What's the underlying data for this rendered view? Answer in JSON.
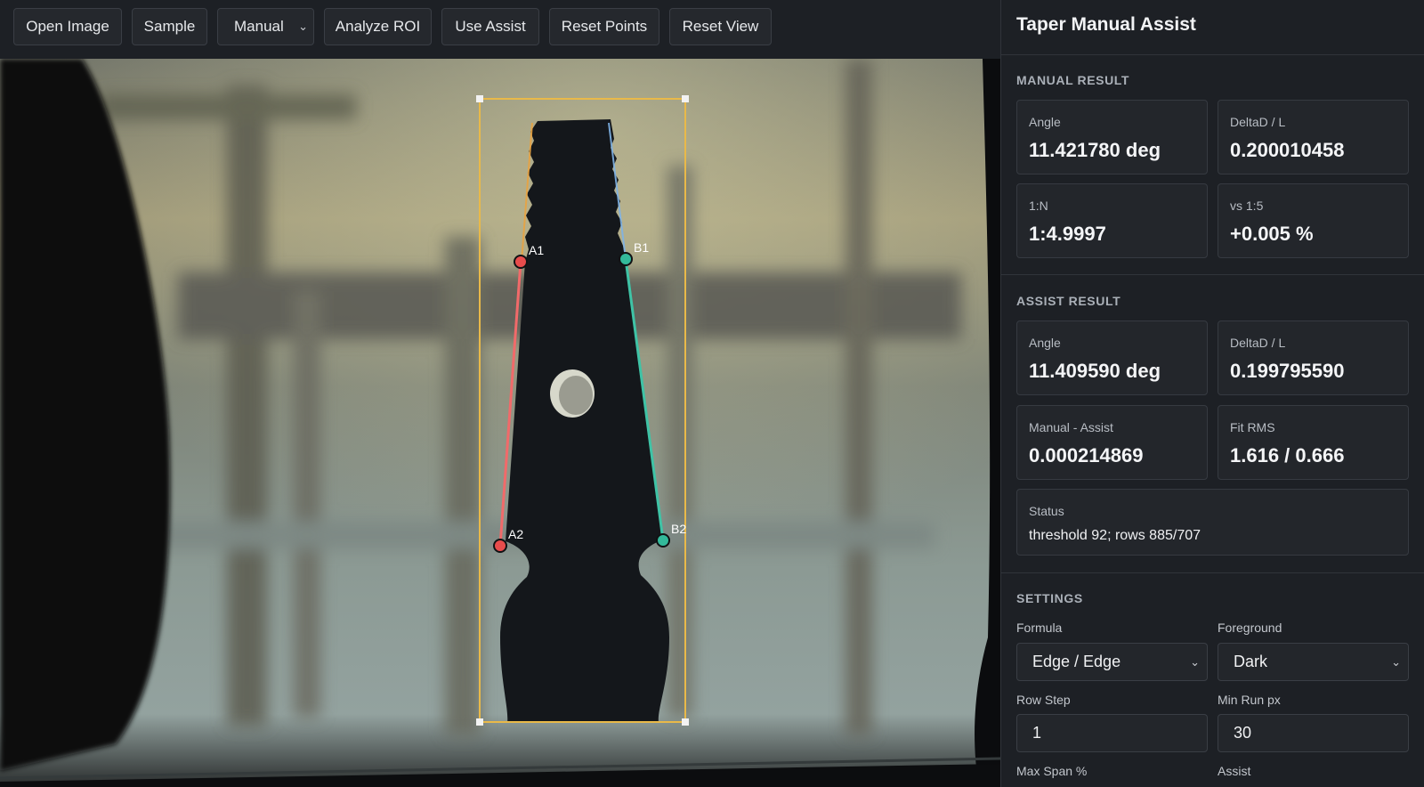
{
  "toolbar": {
    "open_image": "Open Image",
    "sample": "Sample",
    "mode_select": "Manual",
    "analyze_roi": "Analyze ROI",
    "use_assist": "Use Assist",
    "reset_points": "Reset Points",
    "reset_view": "Reset View"
  },
  "viewer": {
    "points": {
      "a1": "A1",
      "a2": "A2",
      "b1": "B1",
      "b2": "B2"
    },
    "colors": {
      "roi": "#e9b949",
      "line_a": "#f16a6a",
      "line_b": "#3fc3a6",
      "point_a": "#e84c4c",
      "point_b": "#33b99a"
    }
  },
  "panel": {
    "title": "Taper Manual Assist",
    "manual": {
      "heading": "MANUAL RESULT",
      "angle_label": "Angle",
      "angle_value": "11.421780 deg",
      "deltad_label": "DeltaD / L",
      "deltad_value": "0.200010458",
      "n_label": "1:N",
      "n_value": "1:4.9997",
      "vs_label": "vs 1:5",
      "vs_value": "+0.005 %"
    },
    "assist": {
      "heading": "ASSIST RESULT",
      "angle_label": "Angle",
      "angle_value": "11.409590 deg",
      "deltad_label": "DeltaD / L",
      "deltad_value": "0.199795590",
      "diff_label": "Manual - Assist",
      "diff_value": "0.000214869",
      "rms_label": "Fit RMS",
      "rms_value": "1.616 / 0.666",
      "status_label": "Status",
      "status_value": "threshold 92; rows 885/707"
    },
    "settings": {
      "heading": "SETTINGS",
      "formula_label": "Formula",
      "formula_value": "Edge / Edge",
      "foreground_label": "Foreground",
      "foreground_value": "Dark",
      "rowstep_label": "Row Step",
      "rowstep_value": "1",
      "minrun_label": "Min Run px",
      "minrun_value": "30",
      "maxspan_label": "Max Span %",
      "assist_label": "Assist"
    }
  }
}
